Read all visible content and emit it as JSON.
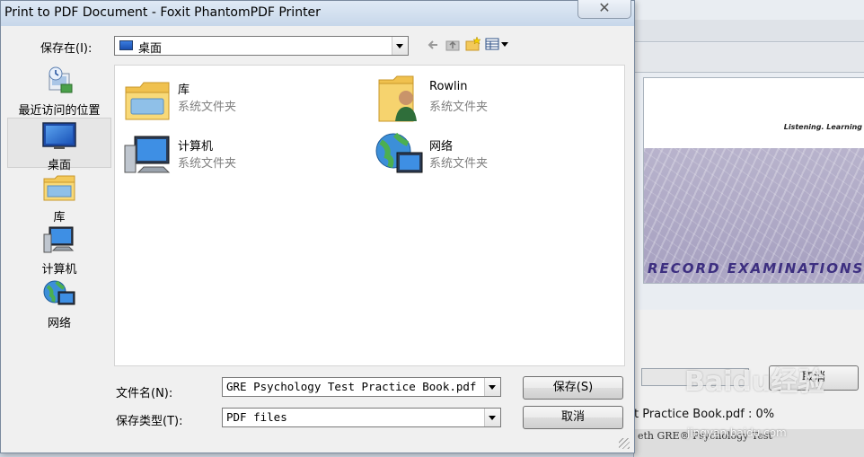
{
  "dialog": {
    "title": "Print to PDF Document - Foxit PhantomPDF Printer",
    "close_glyph": "✕"
  },
  "save_in": {
    "label": "保存在(I):",
    "value": "桌面"
  },
  "nav": {
    "items": [
      {
        "label": "最近访问的位置",
        "icon": "recent-places-icon"
      },
      {
        "label": "桌面",
        "icon": "desktop-icon",
        "selected": true
      },
      {
        "label": "库",
        "icon": "library-icon"
      },
      {
        "label": "计算机",
        "icon": "computer-icon"
      },
      {
        "label": "网络",
        "icon": "network-icon"
      }
    ]
  },
  "files": [
    {
      "name": "库",
      "type": "系统文件夹",
      "icon": "library-folder-icon"
    },
    {
      "name": "Rowlin",
      "type": "系统文件夹",
      "icon": "user-folder-icon"
    },
    {
      "name": "计算机",
      "type": "系统文件夹",
      "icon": "computer-icon"
    },
    {
      "name": "网络",
      "type": "系统文件夹",
      "icon": "network-globe-icon"
    }
  ],
  "filename": {
    "label": "文件名(N):",
    "value": "GRE Psychology Test Practice Book.pdf"
  },
  "filetype": {
    "label": "保存类型(T):",
    "value": "PDF files"
  },
  "buttons": {
    "save": "保存(S)",
    "cancel": "取消"
  },
  "background_window": {
    "tagline": "Listening. Learning",
    "banner": "RECORD EXAMINATIONS®",
    "cancel": "取消",
    "status": "t Practice Book.pdf : 0%",
    "status2": "eth GRE® Psychology Test"
  },
  "watermark": {
    "brand": "Baidu经验",
    "url": "jingyan.baidu.com"
  },
  "colors": {
    "titlebar": "#c7d7ea",
    "accent": "#3d2f80",
    "folder": "#f3c95a"
  }
}
